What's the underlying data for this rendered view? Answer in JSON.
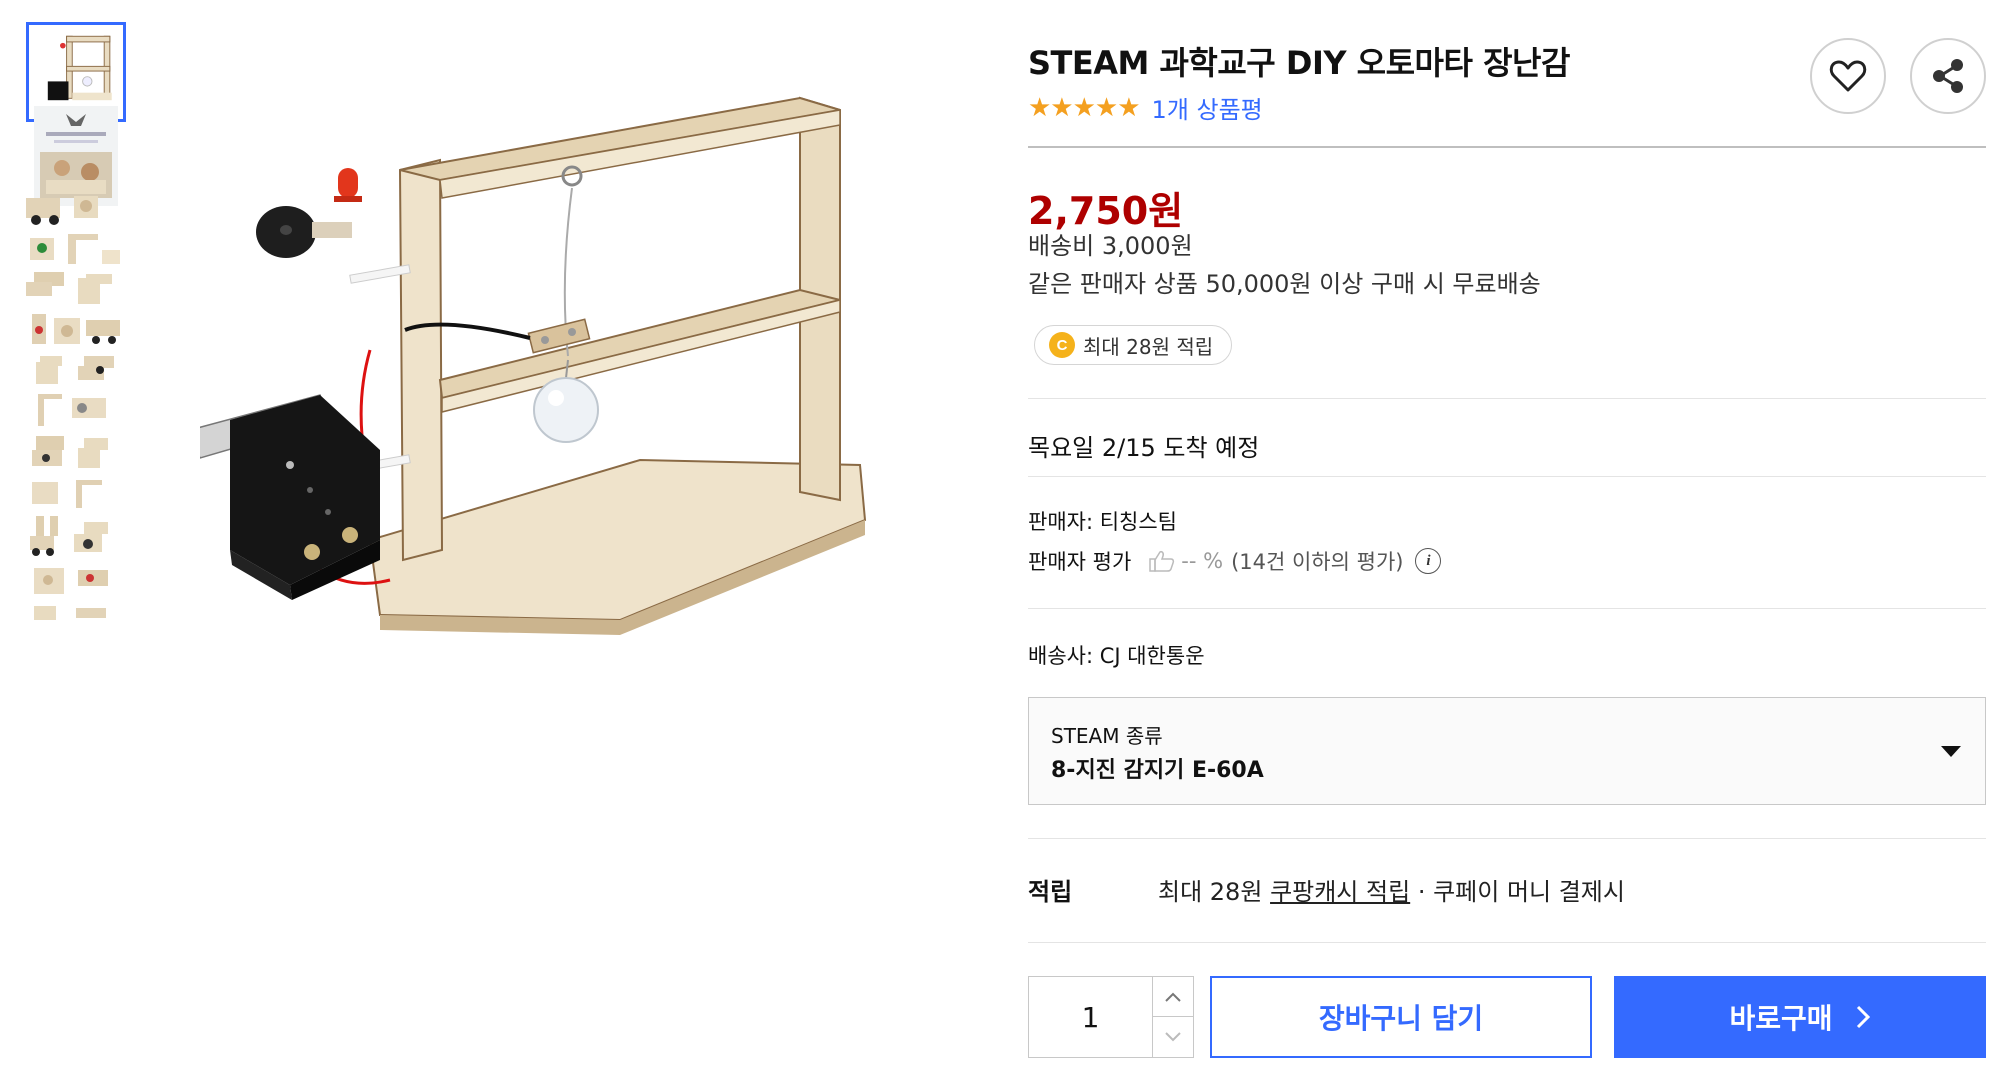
{
  "product": {
    "title": "STEAM 과학교구 DIY 오토마타 장난감",
    "stars": "★★★★★",
    "review_count_label": "1개 상품평",
    "price": "2,750원",
    "shipping_fee": "배송비 3,000원",
    "free_shipping_note": "같은 판매자 상품 50,000원 이상 구매 시 무료배송",
    "point_badge": {
      "coin": "C",
      "label": "최대 28원 적립"
    },
    "arrival": "목요일 2/15 도착 예정",
    "seller_label": "판매자: 티칭스팀",
    "seller_rating": {
      "label": "판매자 평가",
      "value": "-- %",
      "note": "(14건 이하의 평가)",
      "info_icon": "i"
    },
    "carrier": "배송사: CJ 대한통운",
    "option": {
      "label": "STEAM 종류",
      "value": "8-지진 감지기 E-60A"
    },
    "cash": {
      "label": "적립",
      "prefix": "최대 28원",
      "link": "쿠팡캐시 적립",
      "suffix": "· 쿠페이 머니 결제시"
    },
    "quantity": "1",
    "cart_button": "장바구니 담기",
    "buy_button": "바로구매"
  },
  "icons": {
    "wishlist": "heart-icon",
    "share": "share-icon",
    "thumbs_up": "thumbs-up-icon",
    "caret": "caret-down-icon",
    "chevron": "chevron-right-icon"
  },
  "colors": {
    "accent": "#346aff",
    "price": "#ae0000",
    "star": "#f4a020",
    "coin": "#f5b21b"
  }
}
